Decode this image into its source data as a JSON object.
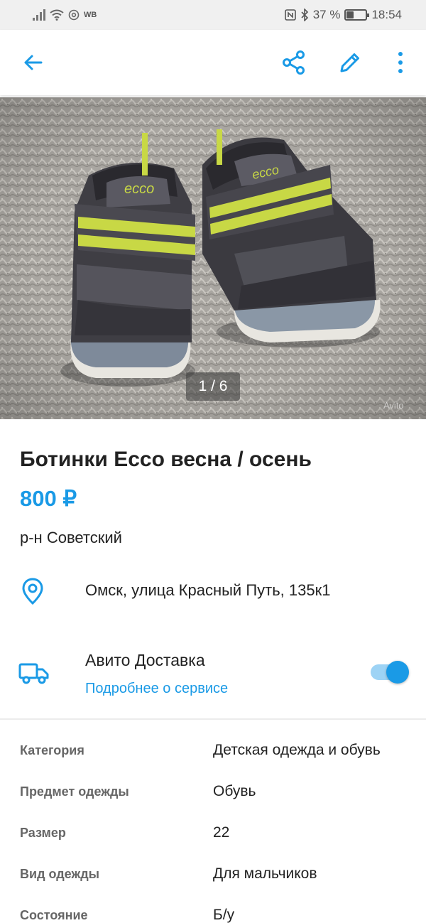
{
  "status_bar": {
    "carrier_badge": "WB",
    "battery": "37 %",
    "battery_level": 0.37,
    "time": "18:54"
  },
  "toolbar": {
    "back_icon": "arrow-left-icon",
    "share_icon": "share-icon",
    "edit_icon": "pencil-icon",
    "more_icon": "more-vertical-icon"
  },
  "gallery": {
    "counter": "1 / 6",
    "watermark": "Avito"
  },
  "listing": {
    "title": "Ботинки Ecco весна / осень",
    "price": "800 ₽",
    "district": "р-н Советский",
    "address": "Омск, улица Красный Путь, 135к1"
  },
  "delivery": {
    "title": "Авито Доставка",
    "link": "Подробнее о сервисе",
    "enabled": true
  },
  "params": [
    {
      "key": "Категория",
      "value": "Детская одежда и обувь"
    },
    {
      "key": "Предмет одежды",
      "value": "Обувь"
    },
    {
      "key": "Размер",
      "value": "22"
    },
    {
      "key": "Вид одежды",
      "value": "Для мальчиков"
    },
    {
      "key": "Состояние",
      "value": "Б/у"
    }
  ],
  "colors": {
    "accent": "#1a9ae6",
    "toggle_track": "#9dd3f5",
    "status_bar_bg": "#f0f0f0"
  }
}
